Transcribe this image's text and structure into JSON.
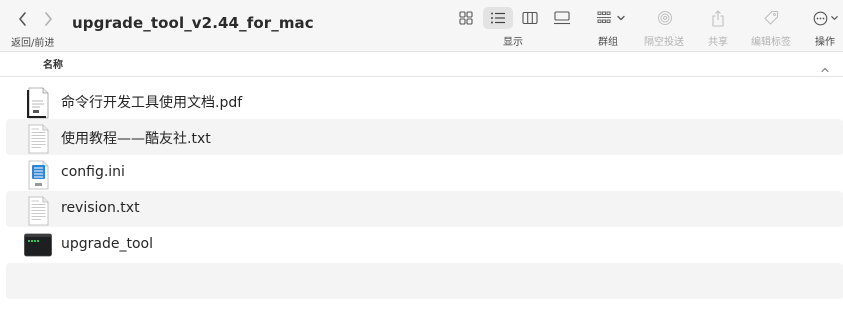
{
  "window": {
    "title": "upgrade_tool_v2.44_for_mac"
  },
  "nav": {
    "label": "返回/前进",
    "back_icon": "chevron-left-icon",
    "forward_icon": "chevron-right-icon"
  },
  "toolbar": {
    "view_label": "显示",
    "group_label": "群组",
    "airdrop_label": "隔空投送",
    "share_label": "共享",
    "tags_label": "编辑标签",
    "action_label": "操作"
  },
  "list": {
    "column_name": "名称",
    "files": [
      {
        "name": "命令行开发工具使用文档.pdf",
        "icon": "pdf-document-icon"
      },
      {
        "name": "使用教程——酷友社.txt",
        "icon": "text-document-icon"
      },
      {
        "name": "config.ini",
        "icon": "ini-document-icon"
      },
      {
        "name": "revision.txt",
        "icon": "text-document-icon"
      },
      {
        "name": "upgrade_tool",
        "icon": "terminal-executable-icon"
      }
    ]
  },
  "colors": {
    "toolbar_bg": "#f6f6f6",
    "row_alt": "#f4f4f5",
    "selected_view_bg": "#e3e3e3"
  }
}
